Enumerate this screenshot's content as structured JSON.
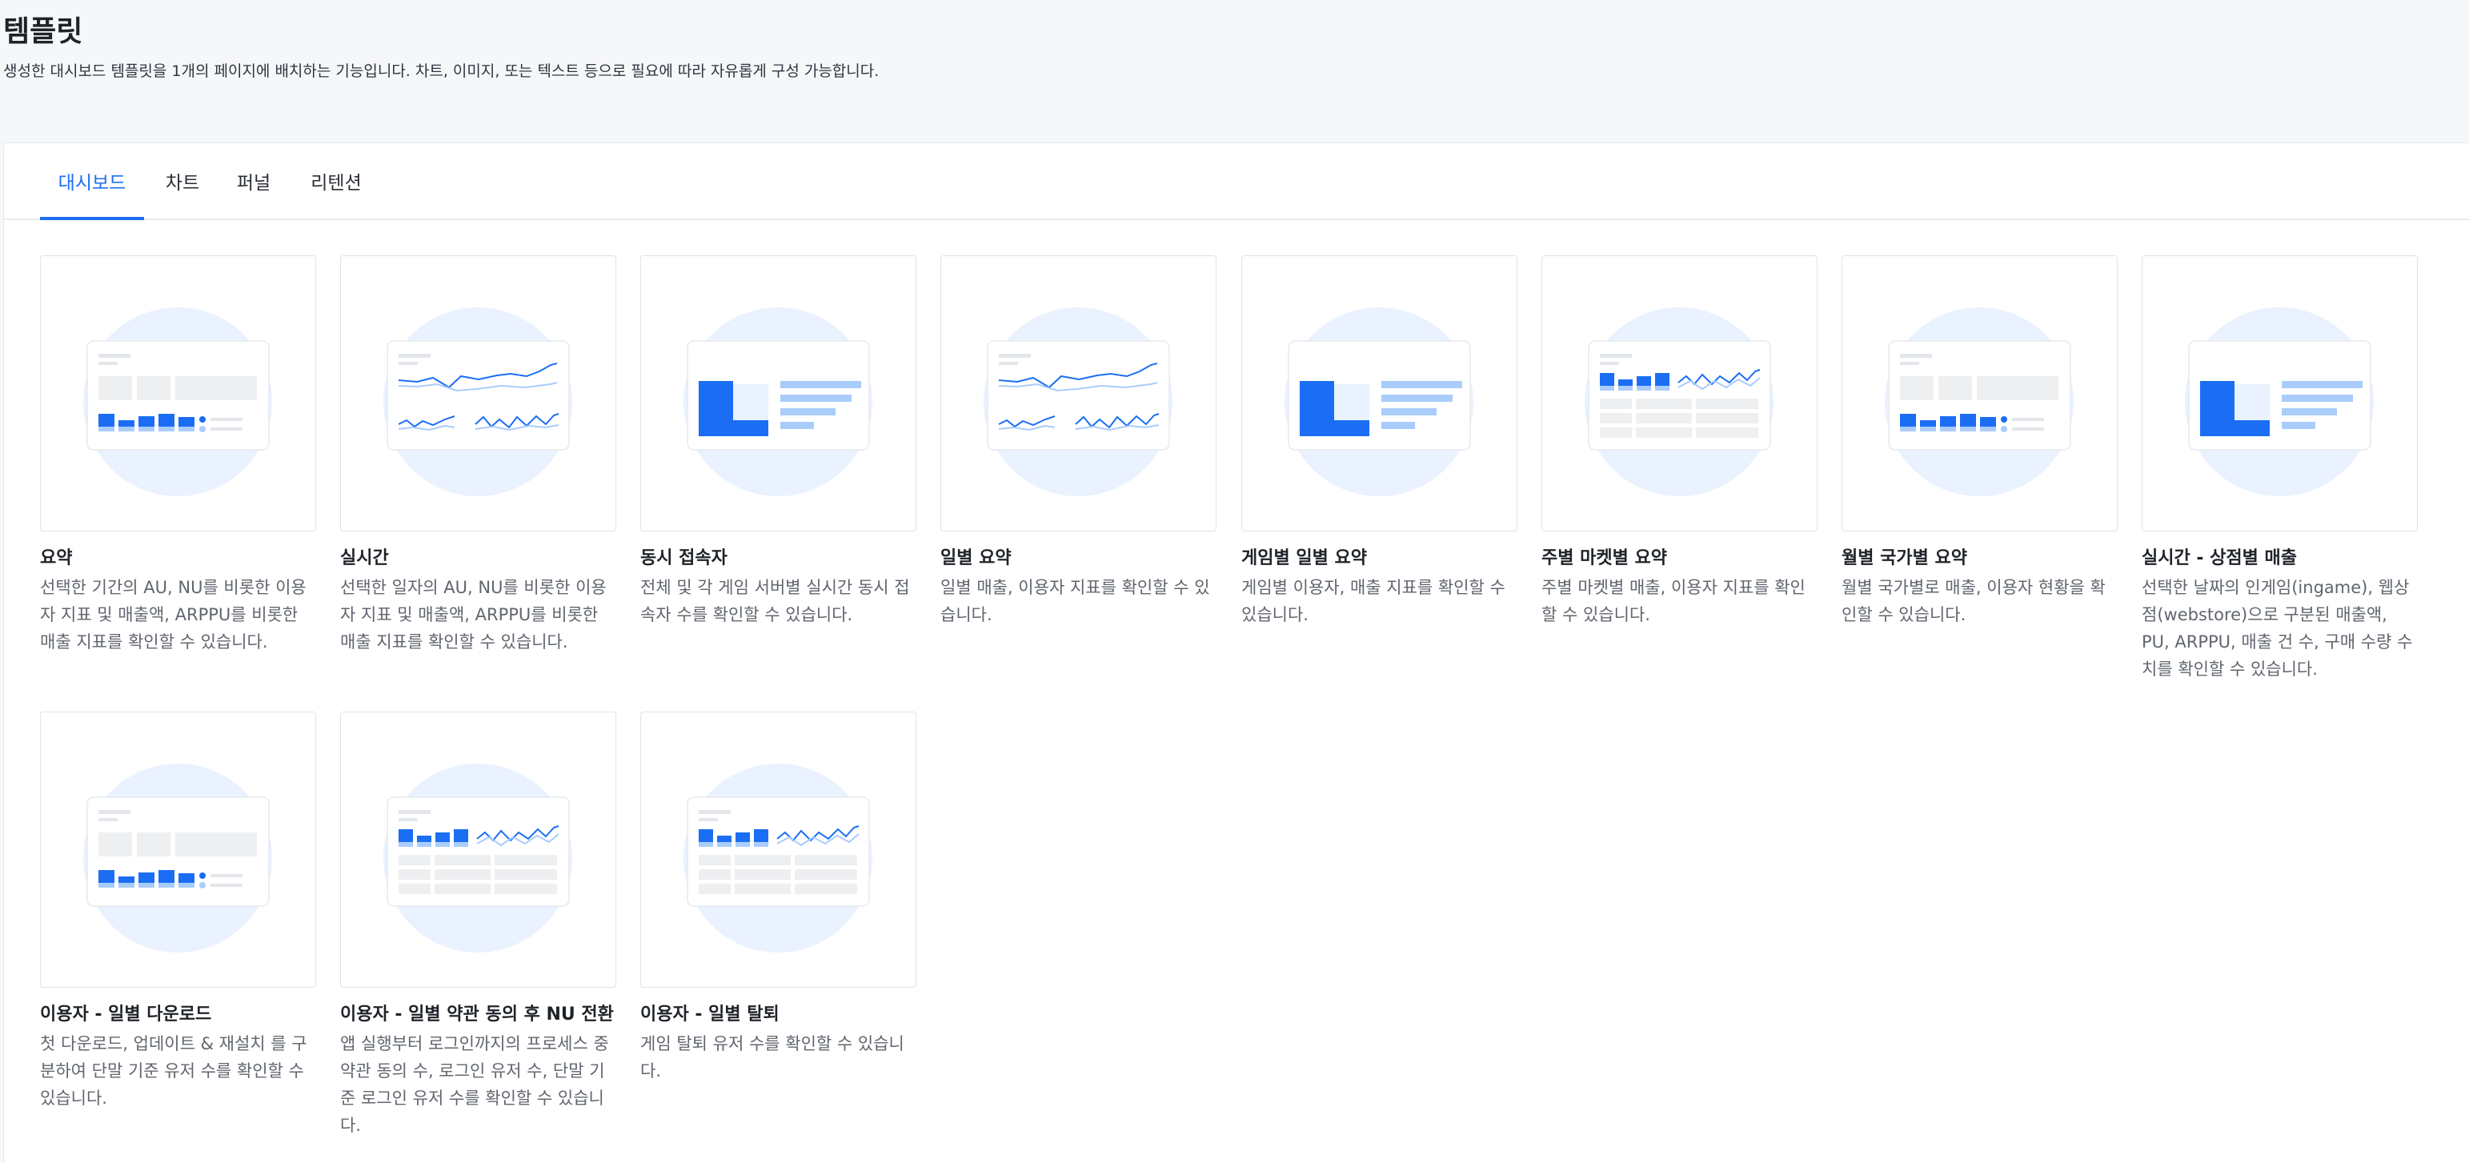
{
  "header": {
    "title": "템플릿",
    "description": "생성한 대시보드 템플릿을 1개의 페이지에 배치하는 기능입니다. 차트, 이미지, 또는 텍스트 등으로 필요에 따라 자유롭게 구성 가능합니다."
  },
  "tabs": [
    {
      "label": "대시보드",
      "active": true
    },
    {
      "label": "차트",
      "active": false
    },
    {
      "label": "퍼널",
      "active": false
    },
    {
      "label": "리텐션",
      "active": false
    }
  ],
  "colors": {
    "accent": "#1b6ef3",
    "light_accent": "#a9ccfb",
    "circle": "#e9f2fe"
  },
  "templates": [
    {
      "title": "요약",
      "description": "선택한 기간의 AU, NU를 비롯한 이용자 지표 및 매출액, ARPPU를 비롯한 매출 지표를 확인할 수 있습니다.",
      "icon": "summary-preview-icon"
    },
    {
      "title": "실시간",
      "description": "선택한 일자의 AU, NU를 비롯한 이용자 지표 및 매출액, ARPPU를 비롯한 매출 지표를 확인할 수 있습니다.",
      "icon": "line-chart-preview-icon"
    },
    {
      "title": "동시 접속자",
      "description": "전체 및 각 게임 서버별 실시간 동시 접속자 수를 확인할 수 있습니다.",
      "icon": "bar-list-preview-icon"
    },
    {
      "title": "일별 요약",
      "description": "일별 매출, 이용자 지표를 확인할 수 있습니다.",
      "icon": "line-chart-preview-icon"
    },
    {
      "title": "게임별 일별 요약",
      "description": "게임별 이용자, 매출 지표를 확인할 수 있습니다.",
      "icon": "bar-list-preview-icon"
    },
    {
      "title": "주별 마켓별 요약",
      "description": "주별 마켓별 매출, 이용자 지표를 확인할 수 있습니다.",
      "icon": "bar-line-table-preview-icon"
    },
    {
      "title": "월별 국가별 요약",
      "description": "월별 국가별로 매출, 이용자 현황을 확인할 수 있습니다.",
      "icon": "summary-preview-icon"
    },
    {
      "title": "실시간 - 상점별 매출",
      "description": "선택한 날짜의 인게임(ingame), 웹상점(webstore)으로 구분된 매출액, PU, ARPPU, 매출 건 수, 구매 수량 수치를 확인할 수 있습니다.",
      "icon": "bar-list-preview-icon"
    },
    {
      "title": "이용자 - 일별 다운로드",
      "description": "첫 다운로드, 업데이트 & 재설치 를 구분하여 단말 기준 유저 수를 확인할 수 있습니다.",
      "icon": "summary-preview-icon"
    },
    {
      "title": "이용자 - 일별 약관 동의 후 NU 전환",
      "description": "앱 실행부터 로그인까지의 프로세스 중 약관 동의 수, 로그인 유저 수, 단말 기준 로그인 유저 수를 확인할 수 있습니다.",
      "icon": "bar-line-table-preview-icon"
    },
    {
      "title": "이용자 - 일별 탈퇴",
      "description": "게임 탈퇴 유저 수를 확인할 수 있습니다.",
      "icon": "bar-line-table-preview-icon"
    }
  ]
}
